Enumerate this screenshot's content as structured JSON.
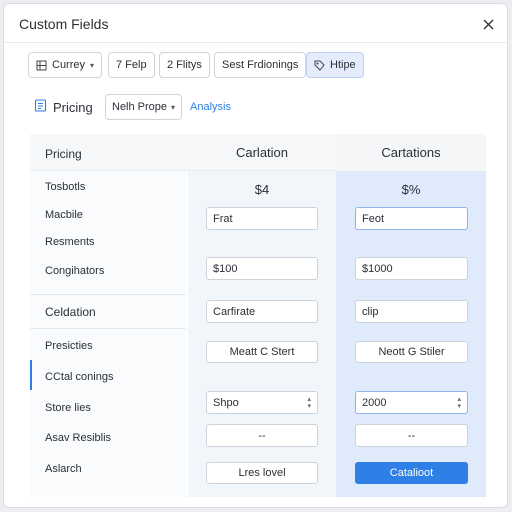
{
  "dialog": {
    "title": "Custom Fields"
  },
  "toolbar": {
    "chips": [
      "Currey",
      "7 Felp",
      "2 Flitys",
      "Sest Frdionings",
      "Htipe"
    ]
  },
  "tabs": {
    "pricing_label": "Pricing",
    "select_value": "Nelh Prope",
    "analysis_link": "Analysis"
  },
  "table": {
    "row_header": "Pricing",
    "col2_header": "Carlation",
    "col3_header": "Cartations",
    "col2_price": "$4",
    "col3_price": "$%",
    "group1_labels": [
      "Tosbotls",
      "Macbile",
      "Resments",
      "Congihators"
    ],
    "group2_title": "Celdation",
    "group2_labels": [
      "Presicties",
      "CCtal conings",
      "Store lies",
      "Asav Resiblis",
      "Aslarch"
    ],
    "col2": {
      "field1": "Frat",
      "field2": "$100",
      "field3": "Carfirate",
      "button1": "Meatt C Stert",
      "select1": "Shpo",
      "field4": "--",
      "button2": "Lres lovel"
    },
    "col3": {
      "field1": "Feot",
      "field2": "$1000",
      "field3": "clip",
      "button1": "Neott G Stiler",
      "select1": "2000",
      "field4": "--",
      "button2": "Catalioot"
    }
  },
  "colors": {
    "accent": "#2e7fe6",
    "selected_column": "#dfeafb"
  },
  "icons": [
    "close-icon",
    "list-icon",
    "tag-icon",
    "document-icon",
    "chevron-down-icon",
    "spinner-arrows-icon"
  ]
}
